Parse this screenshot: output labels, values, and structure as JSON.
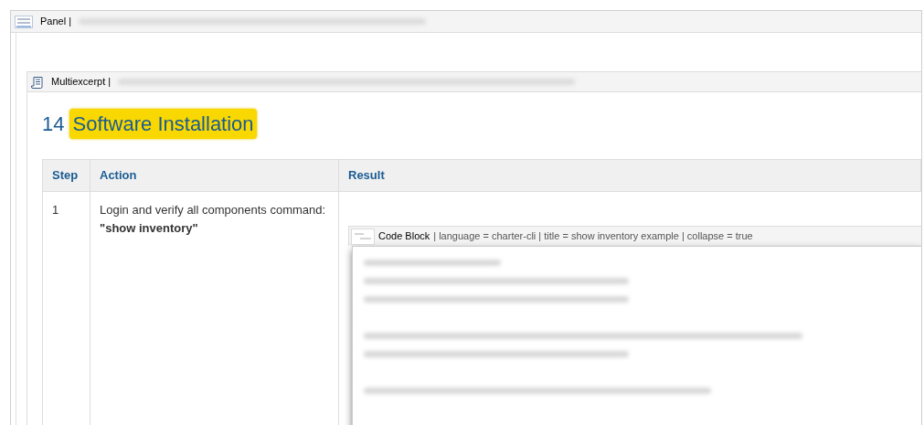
{
  "panel": {
    "label": "Panel |"
  },
  "multiexcerpt": {
    "label": "Multiexcerpt |"
  },
  "heading": {
    "number": "14",
    "title": "Software Installation"
  },
  "table": {
    "columns": [
      "Step",
      "Action",
      "Result"
    ],
    "rows": [
      {
        "step": "1",
        "action": "Login and verify all components command: **\"show inventory\"**"
      }
    ]
  },
  "code_block": {
    "macro": "Code Block",
    "parameters": "| language = charter-cli | title = show inventory example | collapse = true"
  }
}
